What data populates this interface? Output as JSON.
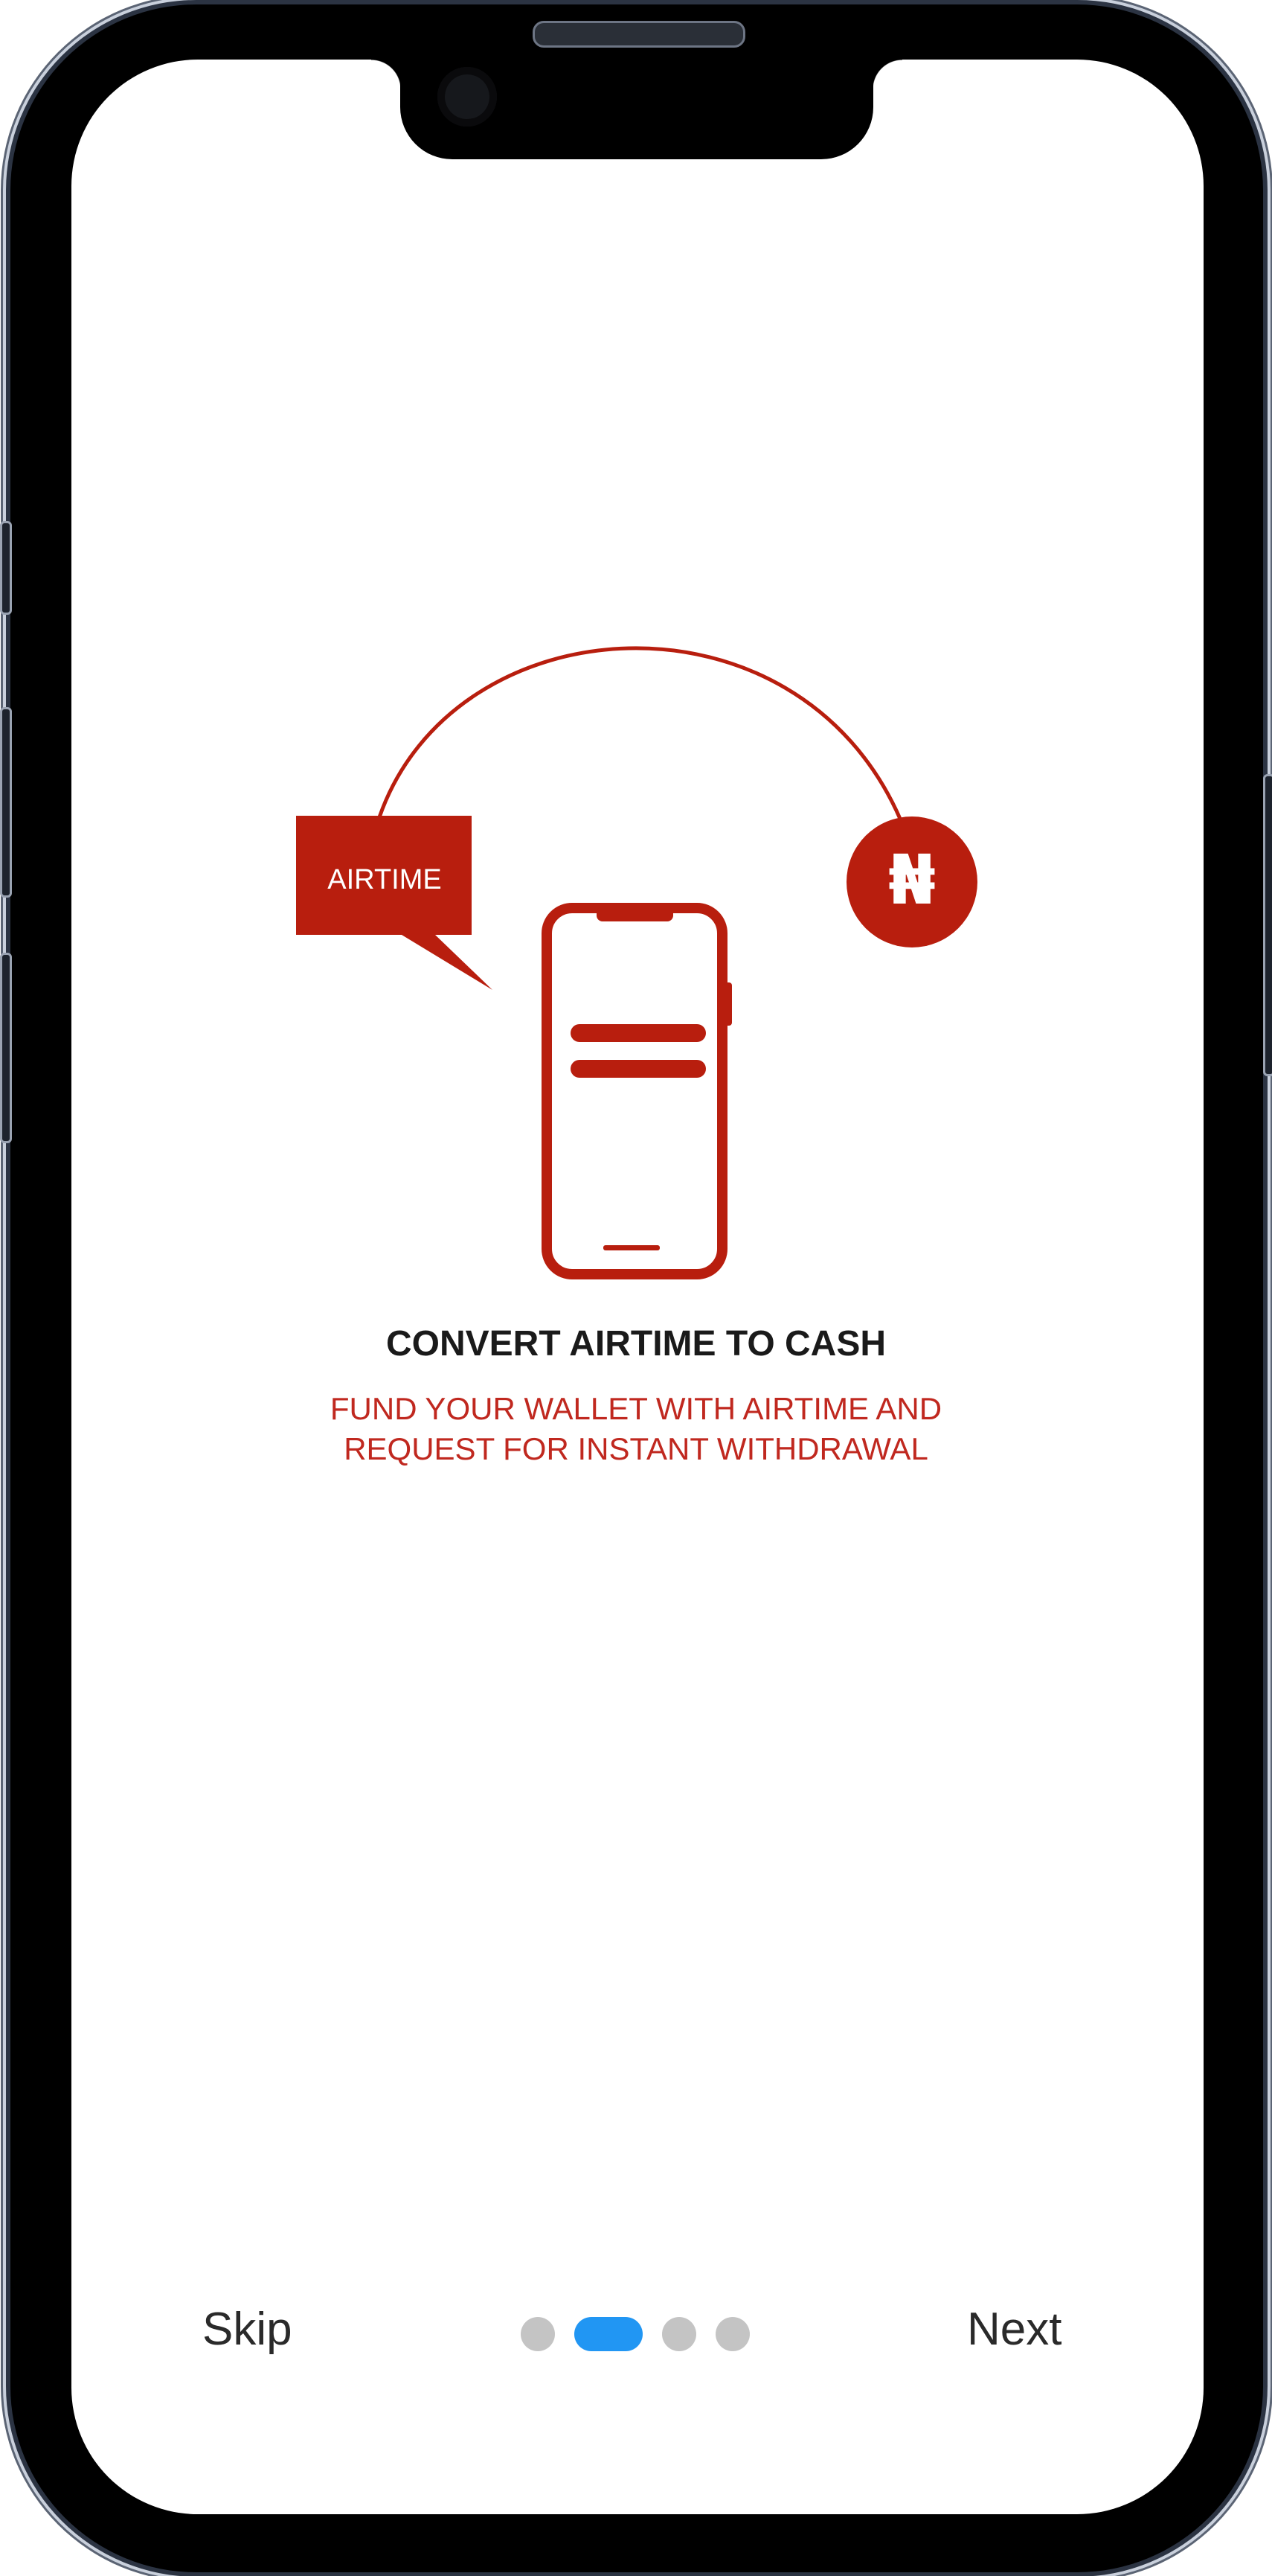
{
  "onboarding": {
    "title": "CONVERT AIRTIME TO CASH",
    "subtitle_line1": "FUND YOUR WALLET WITH AIRTIME AND",
    "subtitle_line2": "REQUEST FOR INSTANT WITHDRAWAL",
    "illustration": {
      "bubble_label": "AIRTIME",
      "currency_symbol": "₦",
      "accent_color": "#b81e0e"
    }
  },
  "navigation": {
    "skip_label": "Skip",
    "next_label": "Next",
    "page_indicator": {
      "total_pages": 4,
      "current_page": 2,
      "active_color": "#2196f3",
      "inactive_color": "#c4c4c4"
    }
  }
}
